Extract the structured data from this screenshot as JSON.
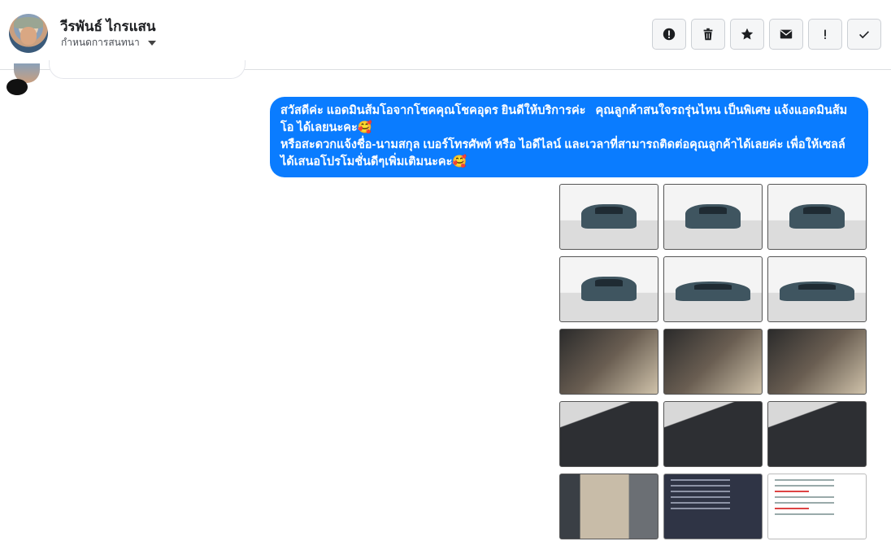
{
  "header": {
    "contact_name": "วีรพันธ์ ไกรแสน",
    "conversation_menu_label": "กำหนดการสนทนา"
  },
  "toolbar": {
    "buttons": [
      {
        "icon": "alert-circle-icon",
        "label": "spam"
      },
      {
        "icon": "trash-icon",
        "label": "delete"
      },
      {
        "icon": "star-icon",
        "label": "star"
      },
      {
        "icon": "envelope-icon",
        "label": "mark-unread"
      },
      {
        "icon": "exclamation-icon",
        "label": "follow-up"
      },
      {
        "icon": "check-icon",
        "label": "done"
      }
    ]
  },
  "message": {
    "line1": "สวัสดีค่ะ แอดมินส้มโอจากโชคคุณโชคอุดร ยินดีให้บริการค่ะ   คุณลูกค้าสนใจรถรุ่นไหน เป็นพิเศษ แจ้งแอดมินส้มโอ ได้เลยนะคะ🥰",
    "line2": "หรือสะดวกแจ้งชื่อ-นามสกุล เบอร์โทรศัพท์ หรือ ไอดีไลน์ และเวลาที่สามารถติดต่อคุณลูกค้าได้เลยค่ะ เพื่อให้เซลล์ได้เสนอโปรโมชั่นดีๆเพิ่มเติมนะคะ🥰",
    "bubble_color": "#0a7cff"
  },
  "gallery": {
    "images": [
      "car-front-photo",
      "car-front-three-quarter-photo",
      "car-rear-three-quarter-photo",
      "car-rear-photo",
      "car-side-photo",
      "car-side-photo-2",
      "car-door-interior-photo",
      "car-dashboard-photo",
      "car-gear-shift-photo",
      "car-engine-photo",
      "car-radio-photo",
      "car-battery-photo",
      "car-rear-seat-photo",
      "spec-sheet-screenshot",
      "post-text-screenshot"
    ]
  }
}
